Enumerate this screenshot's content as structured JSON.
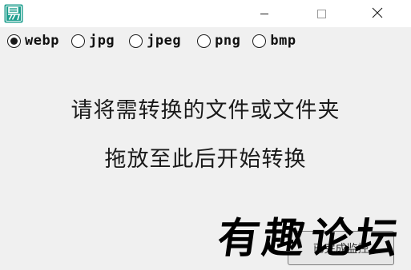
{
  "app": {
    "icon_name": "app-logo-icon",
    "icon_color": "#1e9e8e"
  },
  "window_controls": {
    "minimize_icon": "minimize-icon",
    "maximize_icon": "maximize-icon",
    "close_icon": "close-icon"
  },
  "formats": {
    "options": [
      {
        "label": "webp",
        "selected": true
      },
      {
        "label": "jpg",
        "selected": false
      },
      {
        "label": "jpeg",
        "selected": false
      },
      {
        "label": "png",
        "selected": false
      },
      {
        "label": "bmp",
        "selected": false
      }
    ]
  },
  "drop_zone": {
    "line1": "请将需转换的文件或文件夹",
    "line2": "拖放至此后开始转换"
  },
  "bottom_button": {
    "label": "已完成监控"
  },
  "watermark": {
    "text": "有趣论坛"
  }
}
